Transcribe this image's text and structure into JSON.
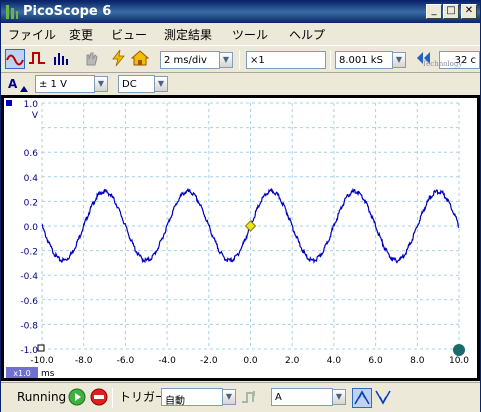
{
  "window": {
    "title": "PicoScope  6"
  },
  "menu": {
    "items": [
      "ファイル",
      "変更",
      "ビュー",
      "測定結果",
      "ツール",
      "ヘルプ"
    ]
  },
  "toolbar": {
    "timebase": "2 ms/div",
    "zoom": "×1",
    "samples": "8.001 kS",
    "capture_count": "32 c",
    "brand": "Technology"
  },
  "channel": {
    "label": "A",
    "range": "± 1 V",
    "coupling": "DC"
  },
  "plot": {
    "y_unit": "V",
    "y_ticks": [
      "1.0",
      "0.6",
      "0.4",
      "0.2",
      "0.0",
      "-0.2",
      "-0.4",
      "-0.6",
      "-0.8",
      "-1.0"
    ],
    "y_values": [
      1.0,
      0.6,
      0.4,
      0.2,
      0.0,
      -0.2,
      -0.4,
      -0.6,
      -0.8,
      -1.0
    ],
    "x_ticks": [
      "-10.0",
      "-8.0",
      "-6.0",
      "-4.0",
      "-2.0",
      "0.0",
      "2.0",
      "4.0",
      "6.0",
      "8.0",
      "10.0"
    ],
    "x_unit": "ms",
    "x_zoom": "x1.0",
    "trace_color": "#0000c0",
    "grid_color": "#a8d0e6"
  },
  "chart_data": {
    "type": "line",
    "xlabel": "ms",
    "ylabel": "V",
    "xlim": [
      -10.0,
      10.0
    ],
    "ylim": [
      -1.0,
      1.0
    ],
    "series": [
      {
        "period_ms": 4.0,
        "amplitude_v": 0.28,
        "offset_v": 0.0,
        "phase_at_zero": 0.0
      }
    ],
    "trigger_point": {
      "x": 0.0,
      "y": 0.0
    }
  },
  "bottom": {
    "status": "Running",
    "trigger_label": "トリガー",
    "trigger_mode": "自動",
    "trigger_channel": "A"
  }
}
